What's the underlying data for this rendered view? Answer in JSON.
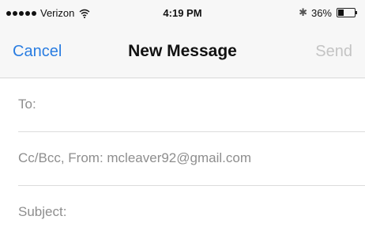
{
  "status_bar": {
    "carrier": "Verizon",
    "time": "4:19 PM",
    "battery_percent": "36%",
    "battery_level": 0.36,
    "icons": [
      "signal-dots-icon",
      "wifi-icon",
      "bluetooth-icon",
      "battery-icon"
    ]
  },
  "nav": {
    "cancel_label": "Cancel",
    "title": "New Message",
    "send_label": "Send"
  },
  "fields": {
    "to_label": "To:",
    "cc_bcc_from_label": "Cc/Bcc, From: mcleaver92@gmail.com",
    "subject_label": "Subject:"
  },
  "colors": {
    "accent": "#2a7de1",
    "disabled": "#c4c4c4",
    "placeholder": "#8e8e8e",
    "bar_background": "#f7f7f7"
  }
}
